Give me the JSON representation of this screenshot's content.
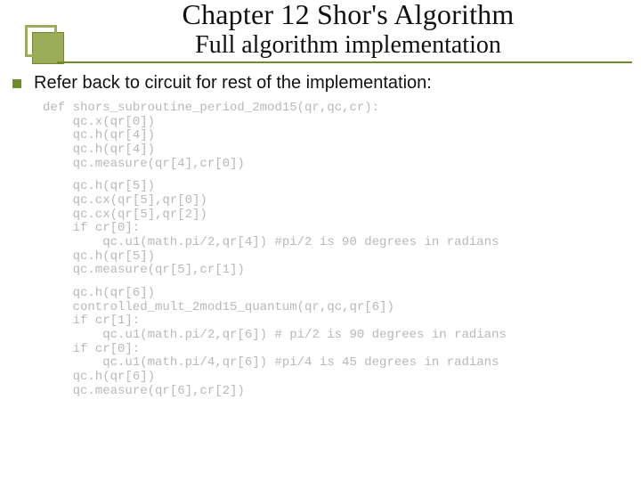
{
  "header": {
    "title": "Chapter 12 Shor's Algorithm",
    "subtitle": "Full algorithm implementation"
  },
  "body": {
    "bullet_text": "Refer back to circuit for rest of the implementation:",
    "code_lines": [
      "def shors_subroutine_period_2mod15(qr,qc,cr):",
      "    qc.x(qr[0])",
      "    qc.h(qr[4])",
      "    qc.h(qr[4])",
      "    qc.measure(qr[4],cr[0])",
      "",
      "    qc.h(qr[5])",
      "    qc.cx(qr[5],qr[0])",
      "    qc.cx(qr[5],qr[2])",
      "    if cr[0]:",
      "        qc.u1(math.pi/2,qr[4]) #pi/2 is 90 degrees in radians",
      "    qc.h(qr[5])",
      "    qc.measure(qr[5],cr[1])",
      "",
      "    qc.h(qr[6])",
      "    controlled_mult_2mod15_quantum(qr,qc,qr[6])",
      "    if cr[1]:",
      "        qc.u1(math.pi/2,qr[6]) # pi/2 is 90 degrees in radians",
      "    if cr[0]:",
      "        qc.u1(math.pi/4,qr[6]) #pi/4 is 45 degrees in radians",
      "    qc.h(qr[6])",
      "    qc.measure(qr[6],cr[2])"
    ]
  }
}
